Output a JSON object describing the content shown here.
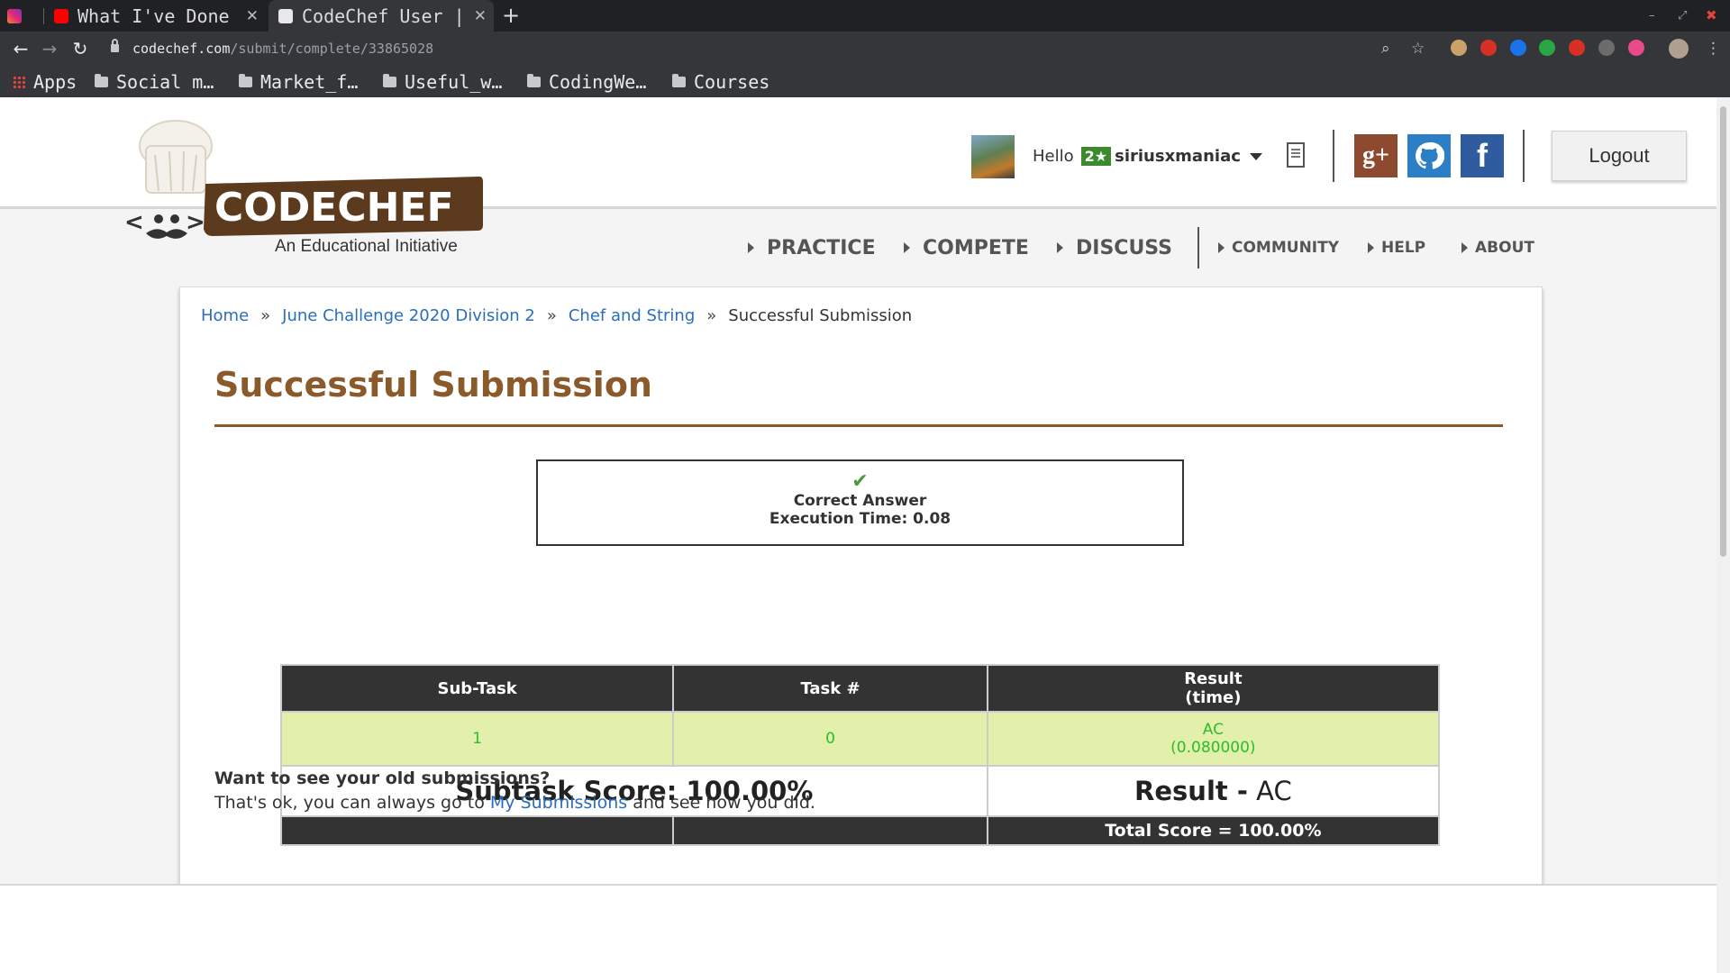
{
  "browser": {
    "tabs": [
      {
        "title": "What I've Done",
        "icon": "youtube-icon"
      },
      {
        "title": "CodeChef User |",
        "icon": "codechef-icon"
      }
    ],
    "url_host": "codechef.com",
    "url_path": "/submit/complete/33865028",
    "bookmarks": [
      "Apps",
      "Social m…",
      "Market_f…",
      "Useful_w…",
      "CodingWe…",
      "Courses"
    ]
  },
  "site": {
    "logo_text": "CODECHEF",
    "tagline": "An Educational Initiative",
    "hello": "Hello",
    "rating_badge": "2★",
    "username": "siriusxmaniac",
    "logout": "Logout",
    "nav_main": [
      "PRACTICE",
      "COMPETE",
      "DISCUSS"
    ],
    "nav_secondary": [
      "COMMUNITY",
      "HELP",
      "ABOUT"
    ]
  },
  "breadcrumb": {
    "items": [
      "Home",
      "June Challenge 2020 Division 2",
      "Chef and String",
      "Successful Submission"
    ],
    "separator": "»"
  },
  "page_title": "Successful Submission",
  "verdict": {
    "check": "✔",
    "status": "Correct Answer",
    "execution_time": "Execution Time: 0.08"
  },
  "subtasks": {
    "headers": [
      "Sub-Task",
      "Task #",
      "Result",
      "(time)"
    ],
    "row": {
      "subtask": "1",
      "task": "0",
      "result": "AC",
      "time": "(0.080000)"
    },
    "subtask_score": "Subtask Score: 100.00%",
    "result_label": "Result -",
    "result_value": "AC",
    "total_score": "Total Score = 100.00%"
  },
  "old_submissions": {
    "question": "Want to see your old submissions?",
    "text_before": "That's ok, you can always go to",
    "link": "My Submissions",
    "text_after": "and see how you did."
  },
  "colors": {
    "brand_brown": "#8b5a2b",
    "link_blue": "#2a6ebb",
    "ac_green": "#2bbd2b",
    "ac_bg": "#e2f0ac"
  }
}
